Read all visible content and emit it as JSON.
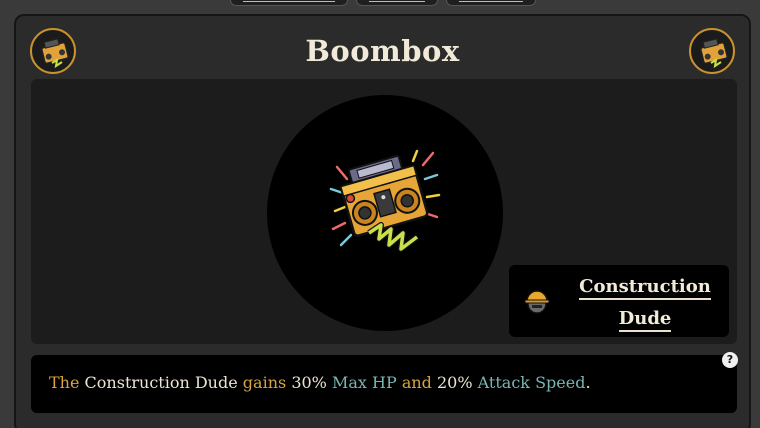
{
  "item": {
    "name": "Boombox",
    "icon": "boombox-icon"
  },
  "character": {
    "name_line1": "Construction",
    "name_line2": "Dude",
    "icon": "hardhat-character-icon"
  },
  "description": {
    "w1": "The",
    "w2": "Construction Dude",
    "w3": "gains",
    "w4": "30%",
    "w5": "Max HP",
    "w6": "and",
    "w7": "20%",
    "w8": "Attack Speed",
    "w9": "."
  },
  "help": {
    "label": "?"
  },
  "colors": {
    "gold": "#d9a440",
    "teal": "#78b6b4",
    "cream": "#f2ead8"
  }
}
